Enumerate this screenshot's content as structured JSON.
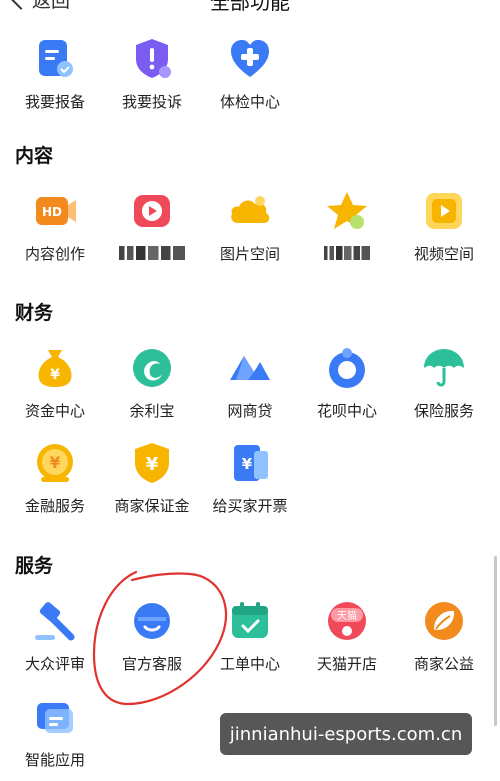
{
  "header": {
    "back_label": "返回",
    "title": "全部功能"
  },
  "top_row": [
    {
      "label": "我要报备",
      "icon": "report-doc-icon"
    },
    {
      "label": "我要投诉",
      "icon": "complaint-shield-icon"
    },
    {
      "label": "体检中心",
      "icon": "health-check-icon"
    }
  ],
  "sections": {
    "content": {
      "title": "内容",
      "items": [
        {
          "label": "内容创作",
          "icon": "hd-video-icon"
        },
        {
          "label": "",
          "icon": "play-tv-icon"
        },
        {
          "label": "图片空间",
          "icon": "cloud-image-icon"
        },
        {
          "label": "",
          "icon": "star-badge-icon"
        },
        {
          "label": "视频空间",
          "icon": "video-play-icon"
        }
      ]
    },
    "finance": {
      "title": "财务",
      "items": [
        {
          "label": "资金中心",
          "icon": "money-bag-icon"
        },
        {
          "label": "余利宝",
          "icon": "yulibao-icon"
        },
        {
          "label": "网商贷",
          "icon": "mybank-loan-icon"
        },
        {
          "label": "花呗中心",
          "icon": "huabei-icon"
        },
        {
          "label": "保险服务",
          "icon": "umbrella-icon"
        },
        {
          "label": "金融服务",
          "icon": "coin-icon"
        },
        {
          "label": "商家保证金",
          "icon": "yuan-shield-icon"
        },
        {
          "label": "给买家开票",
          "icon": "invoice-icon"
        }
      ]
    },
    "service": {
      "title": "服务",
      "items": [
        {
          "label": "大众评审",
          "icon": "gavel-icon"
        },
        {
          "label": "官方客服",
          "icon": "customer-service-icon"
        },
        {
          "label": "工单中心",
          "icon": "calendar-check-icon"
        },
        {
          "label": "天猫开店",
          "icon": "tmall-icon",
          "badge": "天猫"
        },
        {
          "label": "商家公益",
          "icon": "leaf-charity-icon"
        },
        {
          "label": "智能应用",
          "icon": "smart-app-icon"
        }
      ]
    }
  },
  "watermark": "jinnianhui-esports.com.cn",
  "colors": {
    "blue": "#3a7bf5",
    "red": "#f04a5a",
    "yellow": "#f7b500",
    "green": "#2dbf9a",
    "orange": "#f28a1e"
  }
}
